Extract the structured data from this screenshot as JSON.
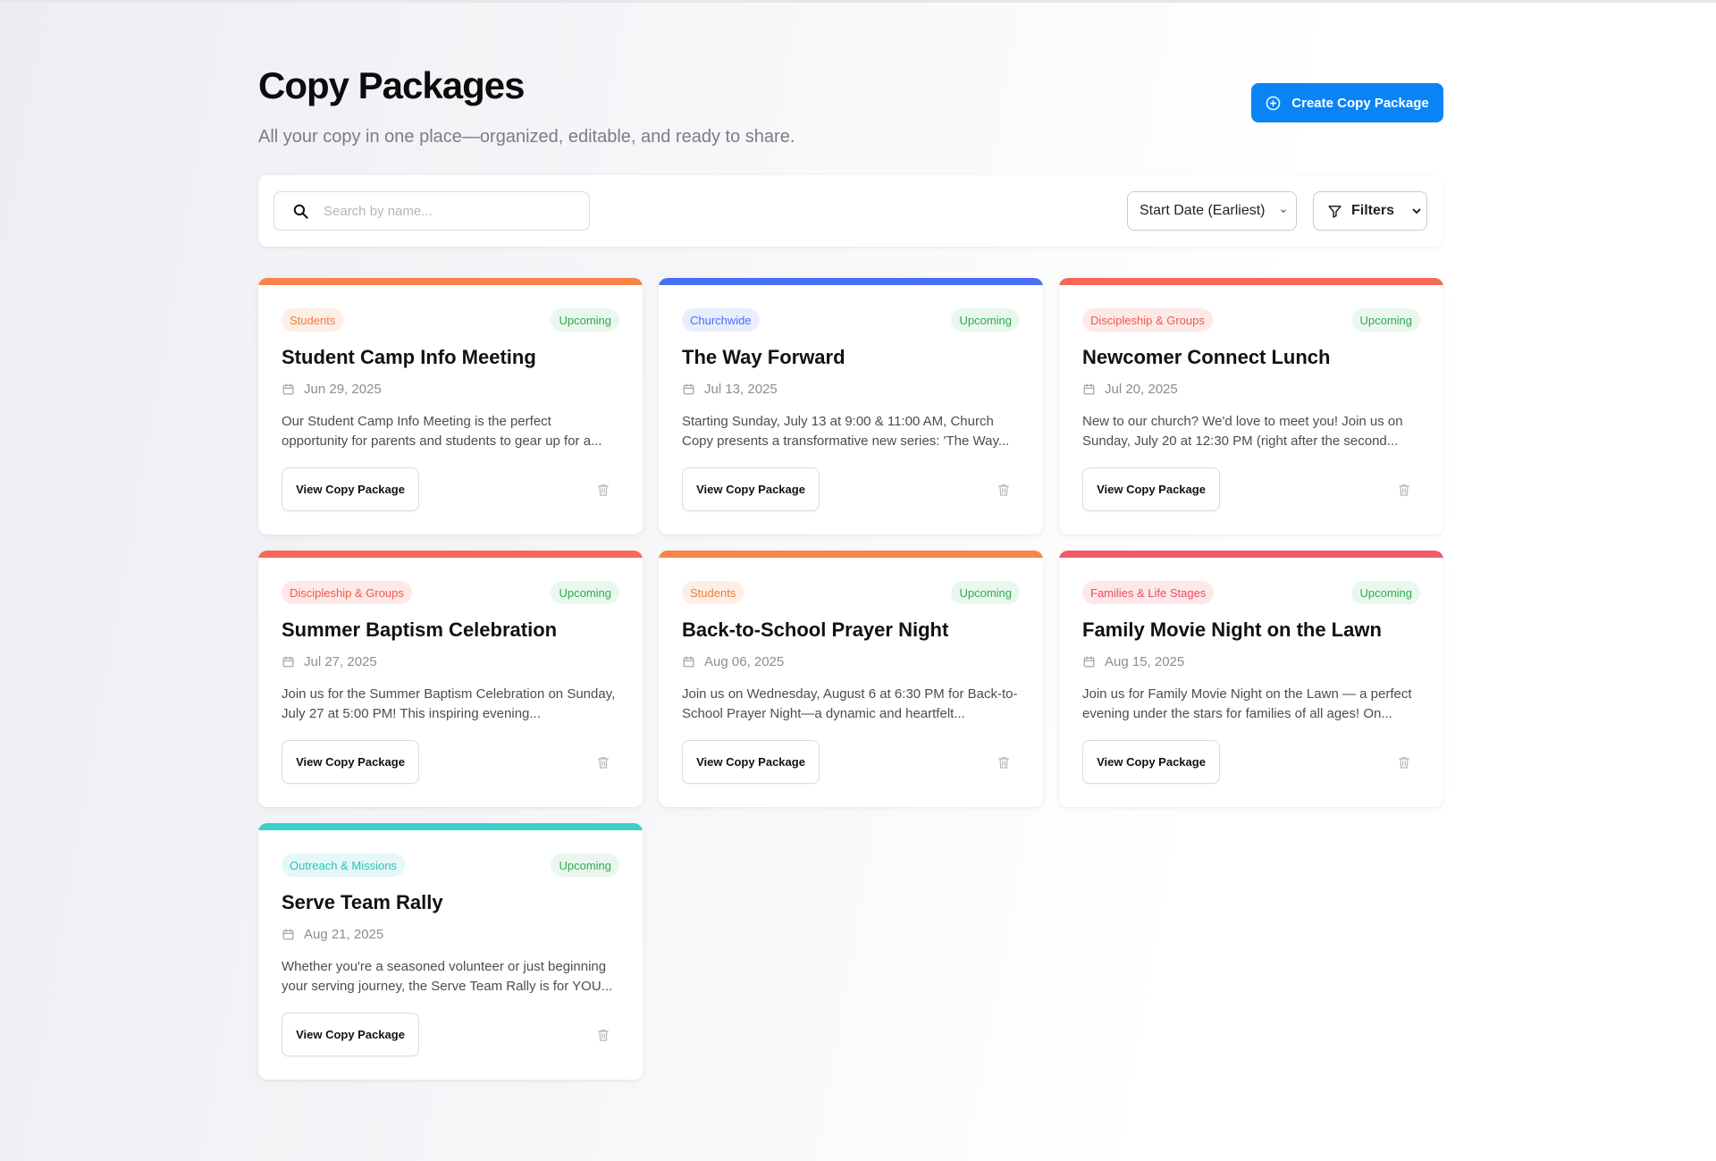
{
  "header": {
    "title": "Copy Packages",
    "subtitle": "All your copy in one place—organized, editable, and ready to share.",
    "create_label": "Create Copy Package"
  },
  "toolbar": {
    "search_placeholder": "Search by name...",
    "sort_value": "Start Date (Earliest)",
    "filters_label": "Filters"
  },
  "card_button_label": "View Copy Package",
  "cards": [
    {
      "category": "Students",
      "status": "Upcoming",
      "title": "Student Camp Info Meeting",
      "date": "Jun 29, 2025",
      "description": "Our Student Camp Info Meeting is the perfect opportunity for parents and students to gear up for a...",
      "accent": "#f7844a",
      "badge_bg": "#fdeee6",
      "badge_fg": "#ef7d3d"
    },
    {
      "category": "Churchwide",
      "status": "Upcoming",
      "title": "The Way Forward",
      "date": "Jul 13, 2025",
      "description": "Starting Sunday, July 13 at 9:00 & 11:00 AM, Church Copy presents a transformative new series: 'The Way...",
      "accent": "#4a6ef5",
      "badge_bg": "#e9eefd",
      "badge_fg": "#4a6ef5"
    },
    {
      "category": "Discipleship & Groups",
      "status": "Upcoming",
      "title": "Newcomer Connect Lunch",
      "date": "Jul 20, 2025",
      "description": "New to our church? We'd love to meet you! Join us on Sunday, July 20 at 12:30 PM (right after the second...",
      "accent": "#f7685a",
      "badge_bg": "#fde9e7",
      "badge_fg": "#ee5a4c"
    },
    {
      "category": "Discipleship & Groups",
      "status": "Upcoming",
      "title": "Summer Baptism Celebration",
      "date": "Jul 27, 2025",
      "description": "Join us for the Summer Baptism Celebration on Sunday, July 27 at 5:00 PM! This inspiring evening...",
      "accent": "#f7685a",
      "badge_bg": "#fde9e7",
      "badge_fg": "#ee5a4c"
    },
    {
      "category": "Students",
      "status": "Upcoming",
      "title": "Back-to-School Prayer Night",
      "date": "Aug 06, 2025",
      "description": "Join us on Wednesday, August 6 at 6:30 PM for Back-to-School Prayer Night—a dynamic and heartfelt...",
      "accent": "#f7844a",
      "badge_bg": "#fdeee6",
      "badge_fg": "#ef7d3d"
    },
    {
      "category": "Families & Life Stages",
      "status": "Upcoming",
      "title": "Family Movie Night on the Lawn",
      "date": "Aug 15, 2025",
      "description": "Join us for Family Movie Night on the Lawn — a perfect evening under the stars for families of all ages! On...",
      "accent": "#f25a6a",
      "badge_bg": "#fde8ea",
      "badge_fg": "#eb4f61"
    },
    {
      "category": "Outreach & Missions",
      "status": "Upcoming",
      "title": "Serve Team Rally",
      "date": "Aug 21, 2025",
      "description": "Whether you're a seasoned volunteer or just beginning your serving journey, the Serve Team Rally is for YOU...",
      "accent": "#3cd0c8",
      "badge_bg": "#e4f8f7",
      "badge_fg": "#2fc2ba"
    }
  ]
}
